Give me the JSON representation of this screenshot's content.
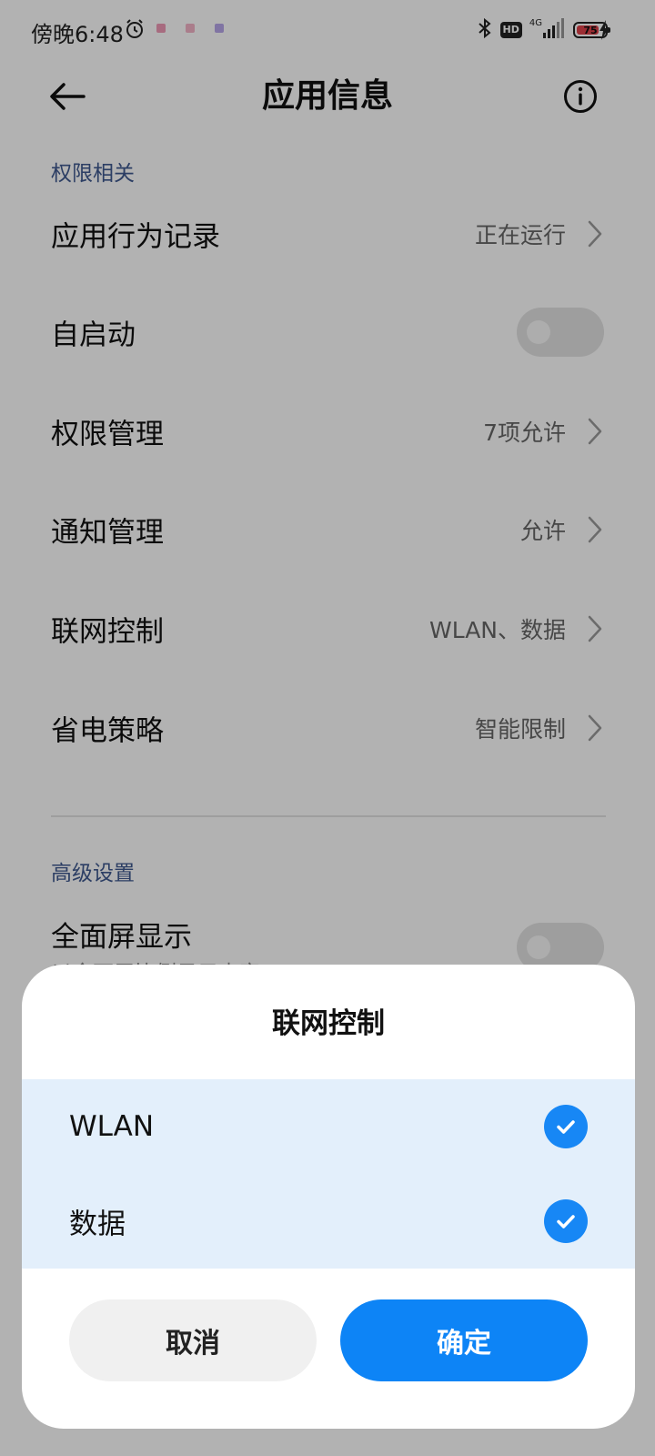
{
  "status_bar": {
    "time": "傍晚6:48",
    "network": "4G",
    "hd_badge": "HD",
    "battery_level": "75",
    "icons": [
      "alarm-icon",
      "notification-icon",
      "bluetooth-icon",
      "signal-icon",
      "battery-icon",
      "charging-icon"
    ]
  },
  "header": {
    "title": "应用信息",
    "back_icon": "arrow-left-icon",
    "info_icon": "info-icon"
  },
  "permissions_section": {
    "label": "权限相关",
    "items": [
      {
        "label": "应用行为记录",
        "value": "正在运行",
        "type": "link"
      },
      {
        "label": "自启动",
        "type": "toggle",
        "on": false
      },
      {
        "label": "权限管理",
        "value": "7项允许",
        "type": "link"
      },
      {
        "label": "通知管理",
        "value": "允许",
        "type": "link"
      },
      {
        "label": "联网控制",
        "value": "WLAN、数据",
        "type": "link"
      },
      {
        "label": "省电策略",
        "value": "智能限制",
        "type": "link"
      }
    ]
  },
  "advanced_section": {
    "label": "高级设置",
    "fullscreen": {
      "label": "全面屏显示",
      "sublabel": "以全面屏比例显示内容",
      "on": false
    }
  },
  "dialog": {
    "title": "联网控制",
    "options": [
      {
        "label": "WLAN",
        "checked": true
      },
      {
        "label": "数据",
        "checked": true
      }
    ],
    "cancel_label": "取消",
    "confirm_label": "确定"
  },
  "colors": {
    "accent": "#0d84f6",
    "option_background": "#e3effb",
    "section_label": "#3f5a90"
  }
}
